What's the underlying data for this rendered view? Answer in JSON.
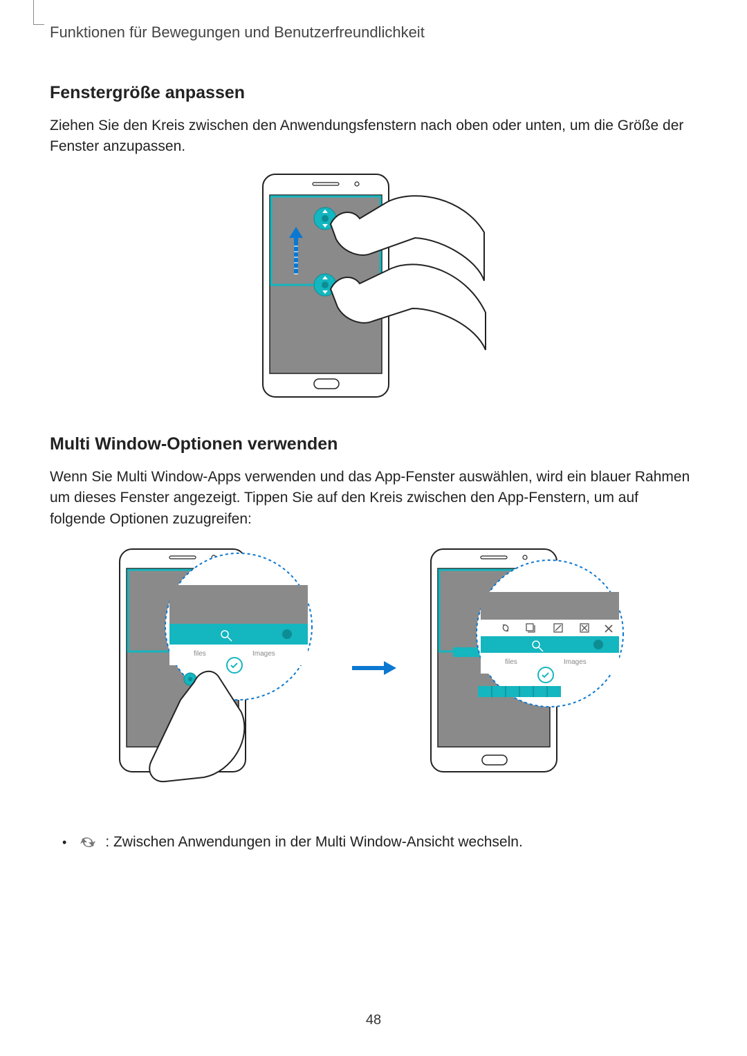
{
  "running_head": "Funktionen für Bewegungen und Benutzerfreundlichkeit",
  "section1": {
    "heading": "Fenstergröße anpassen",
    "body": "Ziehen Sie den Kreis zwischen den Anwendungsfenstern nach oben oder unten, um die Größe der Fenster anzupassen."
  },
  "section2": {
    "heading": "Multi Window-Optionen verwenden",
    "body": "Wenn Sie Multi Window-Apps verwenden und das App-Fenster auswählen, wird ein blauer Rahmen um dieses Fenster angezeigt. Tippen Sie auf den Kreis zwischen den App-Fenstern, um auf folgende Optionen zuzugreifen:"
  },
  "bullet": {
    "icon_name": "swap-icon",
    "text": ": Zwischen Anwendungen in der Multi Window-Ansicht wechseln."
  },
  "page_number": "48"
}
